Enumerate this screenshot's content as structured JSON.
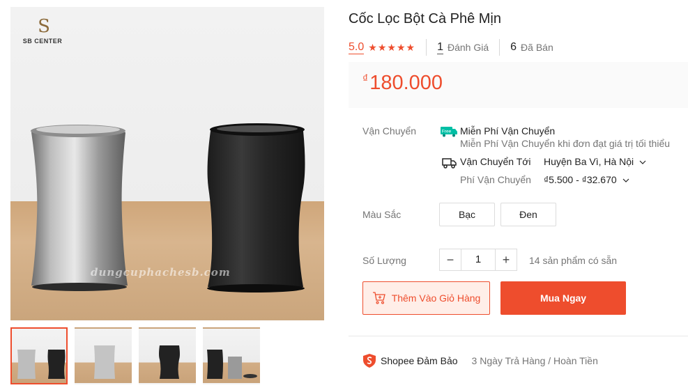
{
  "gallery": {
    "logo_text": "SB CENTER",
    "logo_mark": "S",
    "watermark": "dungcuphachesb.com",
    "thumbnail_count": 4,
    "active_thumbnail": 1
  },
  "product": {
    "title": "Cốc Lọc Bột Cà Phê Mịn",
    "rating": "5.0",
    "stars": 5,
    "review_count": "1",
    "review_label": "Đánh Giá",
    "sold_count": "6",
    "sold_label": "Đã Bán",
    "currency": "₫",
    "price": "180.000"
  },
  "shipping": {
    "label": "Vận Chuyển",
    "free_badge": "Free",
    "free_title": "Miễn Phí Vận Chuyển",
    "free_desc": "Miễn Phí Vận Chuyển khi đơn đạt giá trị tối thiểu",
    "to_label": "Vận Chuyển Tới",
    "to_value": "Huyện Ba Vì, Hà Nội",
    "fee_label": "Phí Vận Chuyển",
    "fee_value": "₫5.500 - ₫32.670"
  },
  "variants": {
    "label": "Màu Sắc",
    "options": [
      "Bạc",
      "Đen"
    ]
  },
  "quantity": {
    "label": "Số Lượng",
    "value": "1",
    "minus": "−",
    "plus": "+",
    "available": "14 sản phẩm có sẵn"
  },
  "actions": {
    "add_to_cart": "Thêm Vào Giỏ Hàng",
    "buy_now": "Mua Ngay"
  },
  "guarantee": {
    "title": "Shopee Đảm Bảo",
    "desc": "3 Ngày Trả Hàng / Hoàn Tiền"
  },
  "colors": {
    "brand": "#ee4d2d",
    "free_badge": "#00bfa5"
  }
}
